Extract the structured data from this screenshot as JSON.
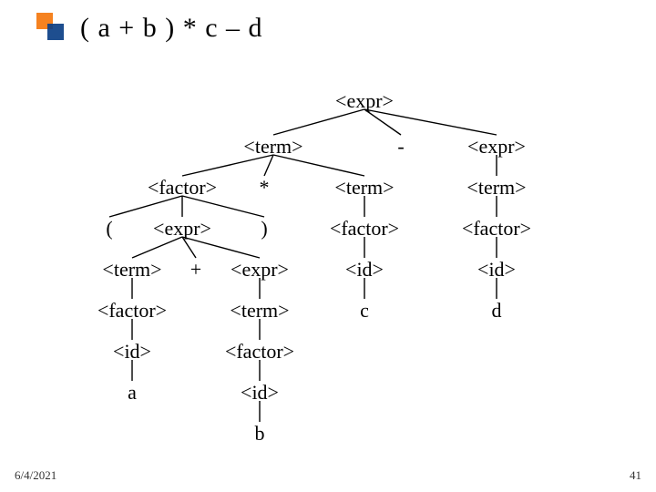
{
  "title": "( a + b ) * c – d",
  "footer": {
    "date": "6/4/2021",
    "page": "41"
  },
  "nodes": {
    "n_expr_root": "<expr>",
    "n_term_L": "<term>",
    "n_minus": "-",
    "n_expr_R": "<expr>",
    "n_factor_L": "<factor>",
    "n_star": "*",
    "n_term_c": "<term>",
    "n_term_d": "<term>",
    "n_lpar": "(",
    "n_expr_ab": "<expr>",
    "n_rpar": ")",
    "n_factor_c": "<factor>",
    "n_factor_d": "<factor>",
    "n_term_a": "<term>",
    "n_plus": "+",
    "n_expr_b": "<expr>",
    "n_id_c": "<id>",
    "n_id_d": "<id>",
    "n_factor_a": "<factor>",
    "n_term_b": "<term>",
    "n_c": "c",
    "n_d": "d",
    "n_id_a": "<id>",
    "n_factor_b": "<factor>",
    "n_a": "a",
    "n_id_b": "<id>",
    "n_b": "b"
  },
  "chart_data": {
    "type": "table",
    "title": "Parse tree for ( a + b ) * c – d",
    "grammar_symbols": [
      "<expr>",
      "<term>",
      "<factor>",
      "<id>",
      "(",
      ")",
      "+",
      "*",
      "-",
      "a",
      "b",
      "c",
      "d"
    ],
    "tree": {
      "label": "<expr>",
      "children": [
        {
          "label": "<term>",
          "children": [
            {
              "label": "<factor>",
              "children": [
                {
                  "label": "("
                },
                {
                  "label": "<expr>",
                  "children": [
                    {
                      "label": "<term>",
                      "children": [
                        {
                          "label": "<factor>",
                          "children": [
                            {
                              "label": "<id>",
                              "children": [
                                {
                                  "label": "a"
                                }
                              ]
                            }
                          ]
                        }
                      ]
                    },
                    {
                      "label": "+"
                    },
                    {
                      "label": "<expr>",
                      "children": [
                        {
                          "label": "<term>",
                          "children": [
                            {
                              "label": "<factor>",
                              "children": [
                                {
                                  "label": "<id>",
                                  "children": [
                                    {
                                      "label": "b"
                                    }
                                  ]
                                }
                              ]
                            }
                          ]
                        }
                      ]
                    }
                  ]
                },
                {
                  "label": ")"
                }
              ]
            },
            {
              "label": "*"
            },
            {
              "label": "<term>",
              "children": [
                {
                  "label": "<factor>",
                  "children": [
                    {
                      "label": "<id>",
                      "children": [
                        {
                          "label": "c"
                        }
                      ]
                    }
                  ]
                }
              ]
            }
          ]
        },
        {
          "label": "-"
        },
        {
          "label": "<expr>",
          "children": [
            {
              "label": "<term>",
              "children": [
                {
                  "label": "<factor>",
                  "children": [
                    {
                      "label": "<id>",
                      "children": [
                        {
                          "label": "d"
                        }
                      ]
                    }
                  ]
                }
              ]
            }
          ]
        }
      ]
    }
  }
}
